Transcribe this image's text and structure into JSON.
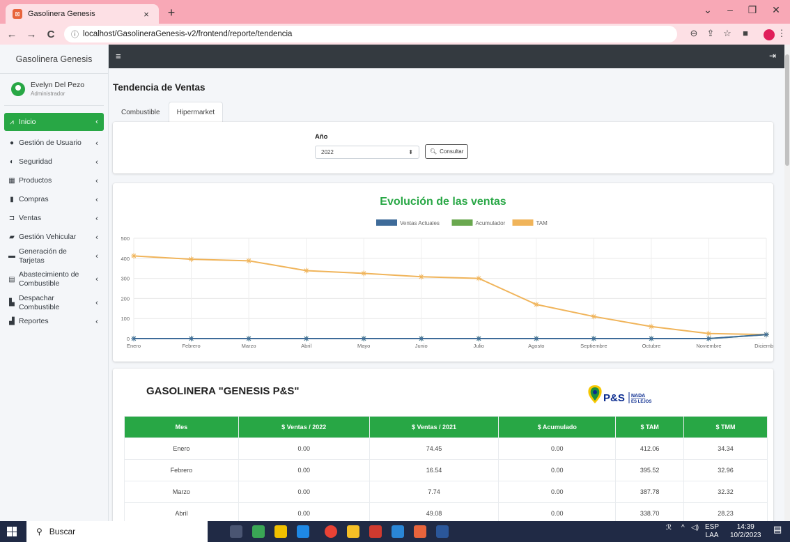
{
  "browser": {
    "tab_title": "Gasolinera Genesis",
    "tab_close": "×",
    "new_tab": "+",
    "url": "localhost/GasolineraGenesis-v2/frontend/reporte/tendencia"
  },
  "sidebar": {
    "brand": "Gasolinera Genesis",
    "user_name": "Evelyn Del Pezo",
    "user_role": "Administrador",
    "items": [
      {
        "label": "Inicio",
        "icon": "chart-line-icon"
      },
      {
        "label": "Gestión de Usuario",
        "icon": "user-icon"
      },
      {
        "label": "Seguridad",
        "icon": "shield-icon"
      },
      {
        "label": "Productos",
        "icon": "boxes-icon"
      },
      {
        "label": "Compras",
        "icon": "truck-icon"
      },
      {
        "label": "Ventas",
        "icon": "cart-icon"
      },
      {
        "label": "Gestión Vehicular",
        "icon": "car-icon"
      },
      {
        "label": "Generación de Tarjetas",
        "icon": "credit-card-icon"
      },
      {
        "label": "Abastecimiento de Combustible",
        "icon": "pallet-icon"
      },
      {
        "label": "Despachar Combustible",
        "icon": "gas-pump-icon"
      },
      {
        "label": "Reportes",
        "icon": "bar-chart-icon"
      }
    ]
  },
  "page": {
    "title": "Tendencia de Ventas",
    "tabs": [
      "Combustible",
      "Hipermarket"
    ],
    "year_label": "Año",
    "year_value": "2022",
    "consult_label": "Consultar"
  },
  "colors": {
    "accent": "#28a745",
    "ventas_actuales": "#3e6b99",
    "acumulador": "#6aa84f",
    "tam": "#f0b45a"
  },
  "chart_data": {
    "type": "line",
    "title": "Evolución de las ventas",
    "categories": [
      "Enero",
      "Febrero",
      "Marzo",
      "Abril",
      "Mayo",
      "Junio",
      "Julio",
      "Agosto",
      "Septiembre",
      "Octubre",
      "Noviembre",
      "Diciembre"
    ],
    "series": [
      {
        "name": "Ventas Actuales",
        "values": [
          0,
          0,
          0,
          0,
          0,
          0,
          0,
          0,
          0,
          0,
          0,
          20
        ]
      },
      {
        "name": "Acumulador",
        "values": [
          0,
          0,
          0,
          0,
          0,
          0,
          0,
          0,
          0,
          0,
          0,
          20
        ]
      },
      {
        "name": "TAM",
        "values": [
          412.06,
          395.52,
          387.78,
          338.7,
          325,
          308,
          300,
          170,
          110,
          60,
          25,
          20
        ]
      }
    ],
    "yticks": [
      0,
      100,
      200,
      300,
      400,
      500
    ],
    "ylim": [
      0,
      500
    ],
    "legend": "top-center",
    "grid": true
  },
  "report": {
    "company": "GASOLINERA \"GENESIS P&S\"",
    "logo_text": "P&S",
    "logo_slogan_1": "NADA",
    "logo_slogan_2": "ES LEJOS",
    "columns": [
      "Mes",
      "$ Ventas / 2022",
      "$ Ventas / 2021",
      "$ Acumulado",
      "$ TAM",
      "$ TMM"
    ],
    "rows": [
      [
        "Enero",
        "0.00",
        "74.45",
        "0.00",
        "412.06",
        "34.34"
      ],
      [
        "Febrero",
        "0.00",
        "16.54",
        "0.00",
        "395.52",
        "32.96"
      ],
      [
        "Marzo",
        "0.00",
        "7.74",
        "0.00",
        "387.78",
        "32.32"
      ],
      [
        "Abril",
        "0.00",
        "49.08",
        "0.00",
        "338.70",
        "28.23"
      ]
    ]
  },
  "taskbar": {
    "search": "Buscar",
    "lang_1": "ESP",
    "lang_2": "LAA",
    "time": "14:39",
    "date": "10/2/2023"
  }
}
